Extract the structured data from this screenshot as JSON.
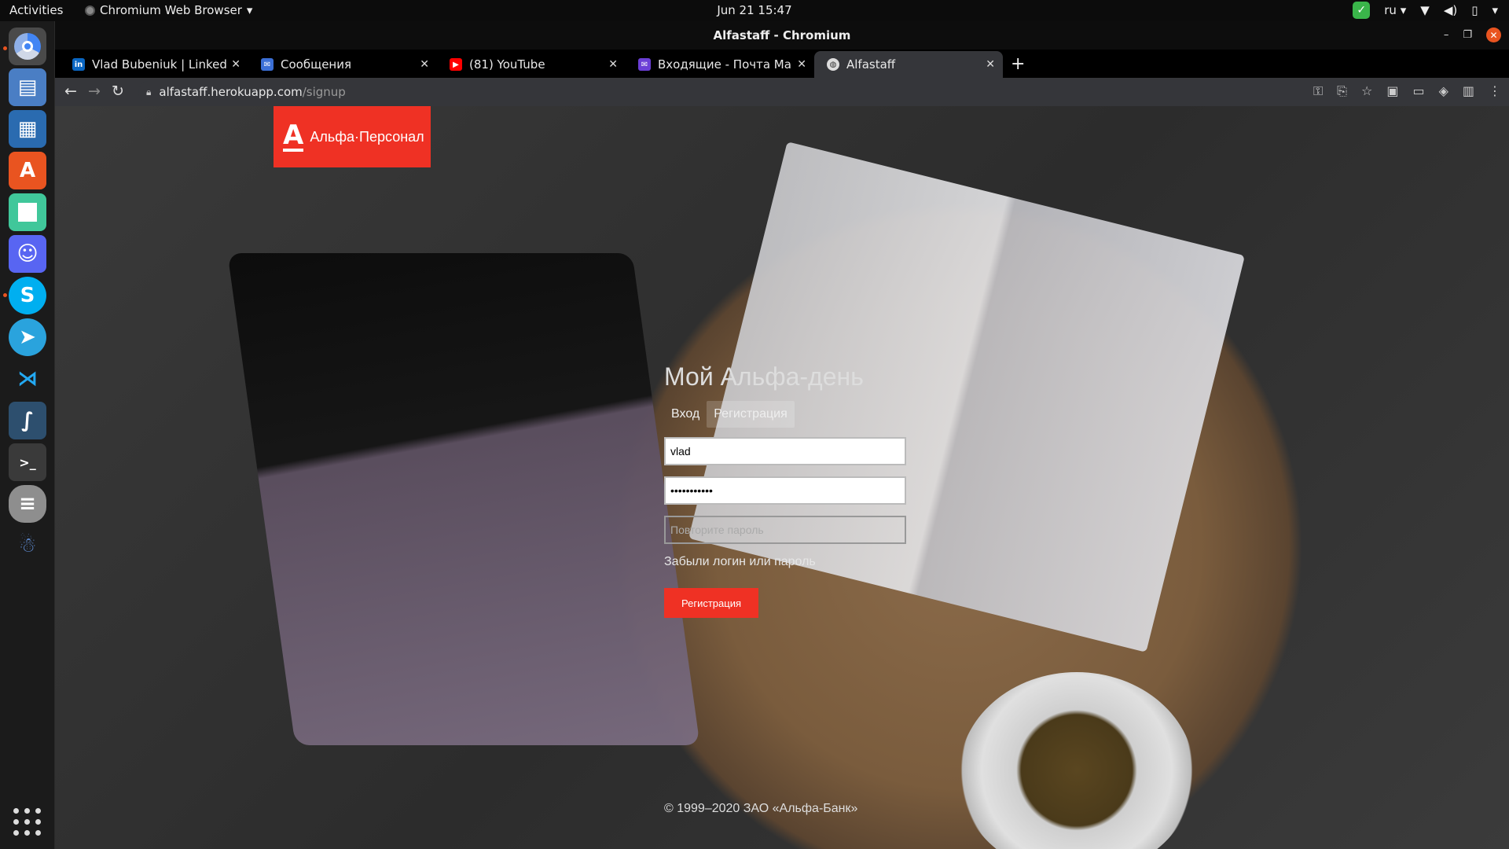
{
  "topbar": {
    "activities": "Activities",
    "app_menu": "Chromium Web Browser",
    "clock": "Jun 21  15:47",
    "lang": "ru"
  },
  "dock": {
    "apps": [
      "chromium-icon",
      "files-icon",
      "libreoffice-writer-icon",
      "software-center-icon",
      "notes-icon",
      "discord-icon",
      "skype-icon",
      "telegram-icon",
      "vscode-icon",
      "mysql-workbench-icon",
      "terminal-icon",
      "database-icon",
      "postgres-icon"
    ]
  },
  "window": {
    "title": "Alfastaff - Chromium"
  },
  "tabs": [
    {
      "label": "Vlad Bubeniuk | LinkedIn",
      "favicon": "in",
      "color": "#0a66c2"
    },
    {
      "label": "Сообщения",
      "favicon": "✉",
      "color": "#3b6fd6"
    },
    {
      "label": "(81) YouTube",
      "favicon": "▶",
      "color": "#ff0000"
    },
    {
      "label": "Входящие - Почта Mail.ru",
      "favicon": "✉",
      "color": "#6b3fd6"
    },
    {
      "label": "Alfastaff",
      "favicon": "◍",
      "color": "#555",
      "active": true
    }
  ],
  "address": {
    "host": "alfastaff.herokuapp.com",
    "path": "/signup"
  },
  "page": {
    "brand": "Альфа·Персонал",
    "title": "Мой Альфа-день",
    "tab_login": "Вход",
    "tab_signup": "Регистрация",
    "username_value": "vlad",
    "password_value": "•••••••••••",
    "repeat_placeholder": "Повторите пароль",
    "forgot": "Забыли логин или пароль",
    "submit": "Регистрация",
    "footer": "© 1999–2020 ЗАО «Альфа-Банк»"
  },
  "colors": {
    "brand_red": "#ef3124",
    "tab_active_bg": "#35363a"
  }
}
